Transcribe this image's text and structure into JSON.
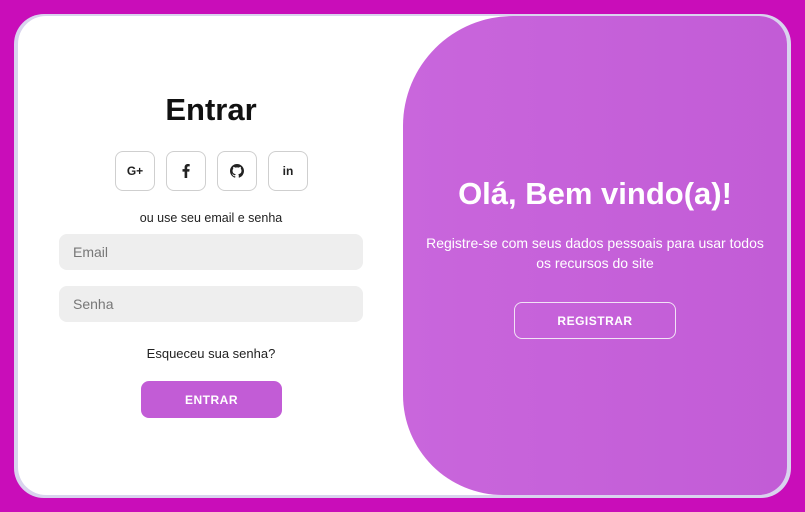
{
  "login": {
    "title": "Entrar",
    "socials": [
      {
        "icon": "google-plus-icon",
        "label": "G+"
      },
      {
        "icon": "facebook-icon",
        "label": "f"
      },
      {
        "icon": "github-icon",
        "label": ""
      },
      {
        "icon": "linkedin-icon",
        "label": "in"
      }
    ],
    "hint": "ou use seu email e senha",
    "email_placeholder": "Email",
    "password_placeholder": "Senha",
    "forgot": "Esqueceu sua senha?",
    "submit_label": "ENTRAR"
  },
  "register_panel": {
    "title": "Olá, Bem vindo(a)!",
    "subtitle": "Registre-se com seus dados pessoais para usar todos os recursos do site",
    "button_label": "REGISTRAR"
  },
  "colors": {
    "page_bg": "#c90db9",
    "accent": "#c25cd6",
    "panel_gradient_start": "#c966dc",
    "field_bg": "#eeeeee"
  }
}
